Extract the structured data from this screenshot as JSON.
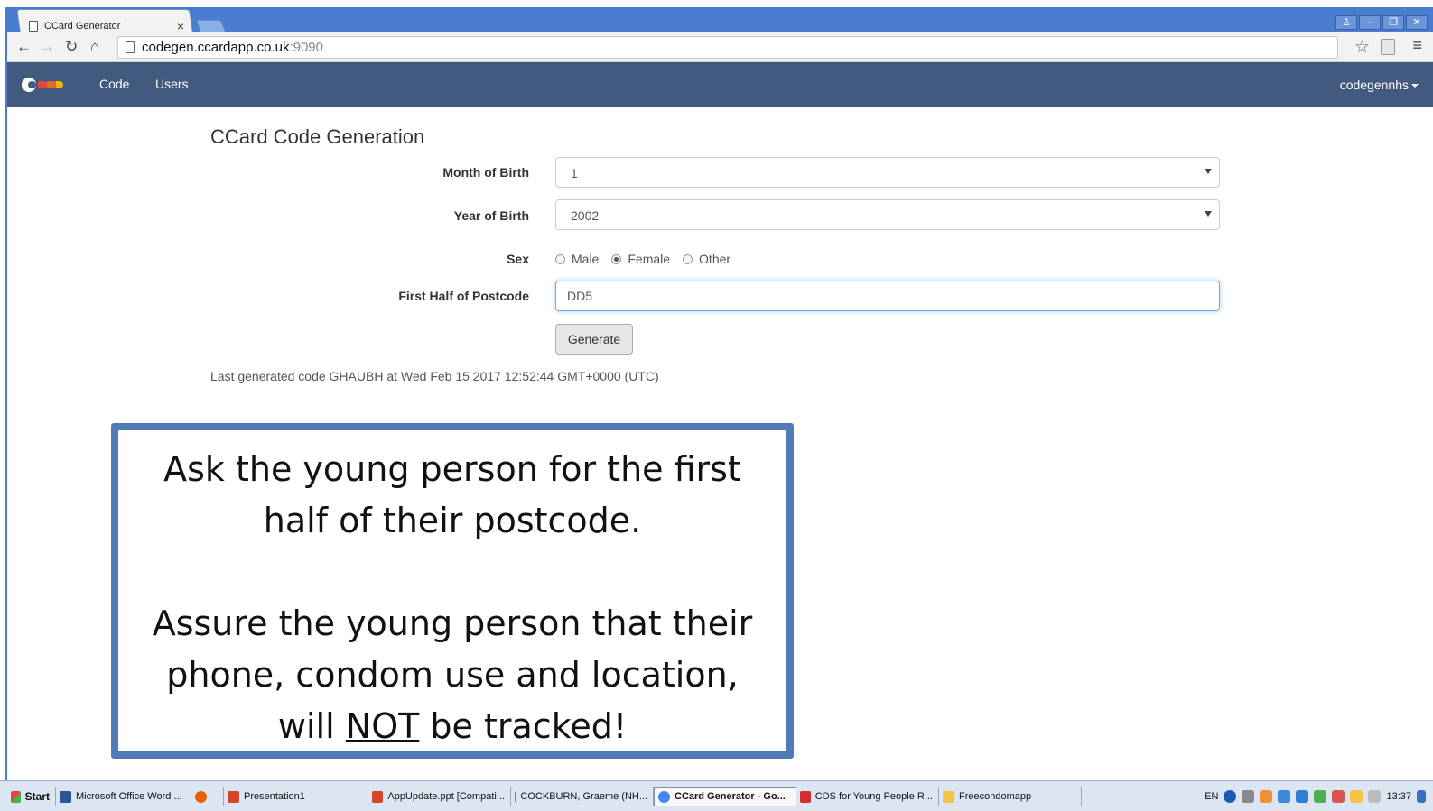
{
  "browser": {
    "tab_title": "CCard Generator",
    "tab_close": "×",
    "url_host": "codegen.ccardapp.co.uk",
    "url_port": ":9090",
    "nav_icons": [
      "back-arrow-icon",
      "forward-arrow-icon",
      "reload-icon",
      "home-icon"
    ],
    "window_controls": [
      "user-icon",
      "minimize-icon",
      "restore-icon",
      "close-icon"
    ]
  },
  "app_nav": {
    "links": [
      "Code",
      "Users"
    ],
    "user": "codegennhs"
  },
  "form": {
    "title": "CCard Code Generation",
    "month_label": "Month of Birth",
    "month_value": "1",
    "year_label": "Year of Birth",
    "year_value": "2002",
    "sex_label": "Sex",
    "sex_options": [
      "Male",
      "Female",
      "Other"
    ],
    "sex_selected": "Female",
    "postcode_label": "First Half of Postcode",
    "postcode_value": "DD5",
    "generate_label": "Generate",
    "last_generated": "Last generated code GHAUBH at Wed Feb 15 2017 12:52:44 GMT+0000 (UTC)"
  },
  "callout": {
    "line1": "Ask the young person for the first",
    "line2": "half of their postcode.",
    "line3": "Assure the young person that their",
    "line4": "phone, condom use and location,",
    "line5_pre": "will ",
    "line5_emph": "NOT",
    "line5_post": " be tracked!"
  },
  "taskbar": {
    "start": "Start",
    "tasks": [
      "Microsoft Office Word ...",
      "Presentation1",
      "AppUpdate.ppt [Compati...",
      "COCKBURN, Graeme (NH...",
      "CCard Generator - Go...",
      "CDS for Young People R...",
      "Freecondomapp"
    ],
    "language": "EN",
    "clock": "13:37"
  },
  "colors": {
    "chrome_blue": "#4a7ccf",
    "navbar": "#415a7d",
    "callout_border": "#4f7cb7",
    "input_focus": "#66afe9"
  }
}
